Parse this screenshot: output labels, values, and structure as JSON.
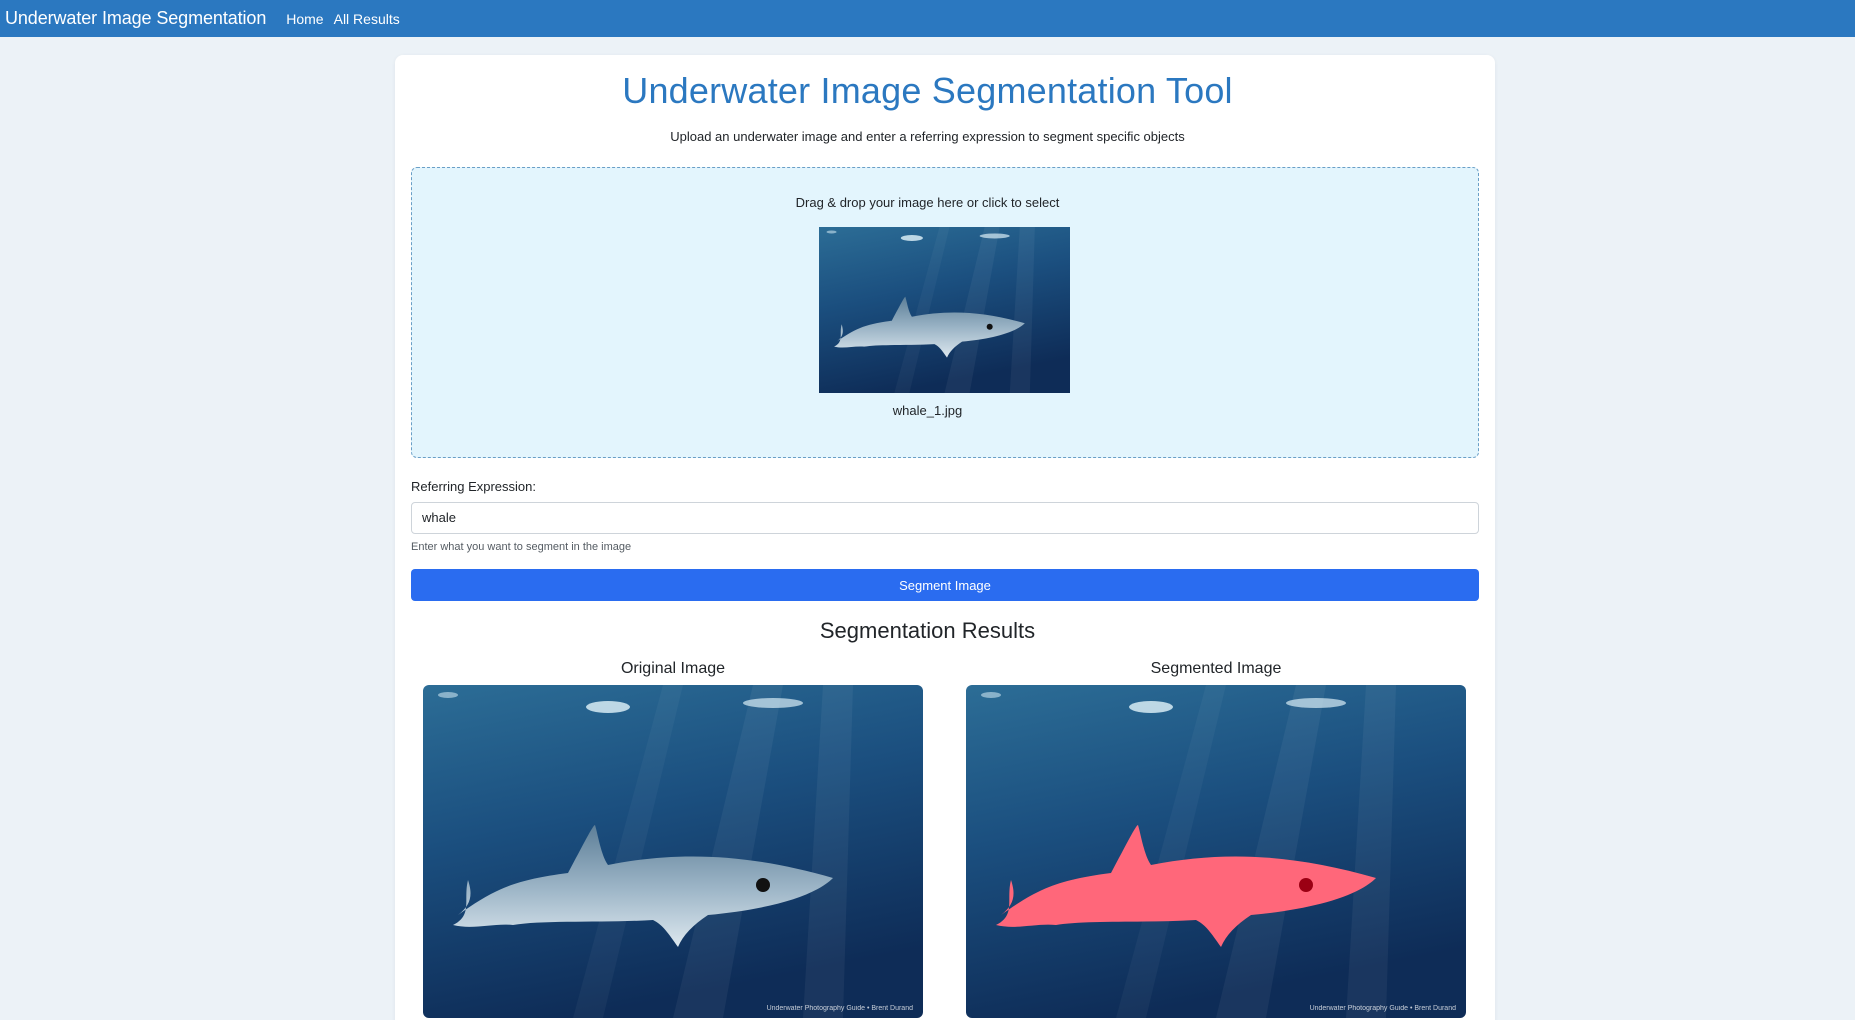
{
  "navbar": {
    "brand": "Underwater Image Segmentation",
    "links": [
      "Home",
      "All Results"
    ]
  },
  "main": {
    "title": "Underwater Image Segmentation Tool",
    "subtitle": "Upload an underwater image and enter a referring expression to segment specific objects"
  },
  "upload": {
    "prompt": "Drag & drop your image here or click to select",
    "filename": "whale_1.jpg"
  },
  "form": {
    "label": "Referring Expression:",
    "value": "whale",
    "help": "Enter what you want to segment in the image",
    "button_label": "Segment Image"
  },
  "results": {
    "title": "Segmentation Results",
    "original_title": "Original Image",
    "segmented_title": "Segmented Image",
    "watermark": "Underwater Photography Guide • Brent Durand"
  },
  "colors": {
    "navbar": "#2b78c0",
    "accent": "#2b78c0",
    "button": "#2a6cf0",
    "dropzone_bg": "#e3f5fd",
    "mask": "#ff4d63"
  }
}
